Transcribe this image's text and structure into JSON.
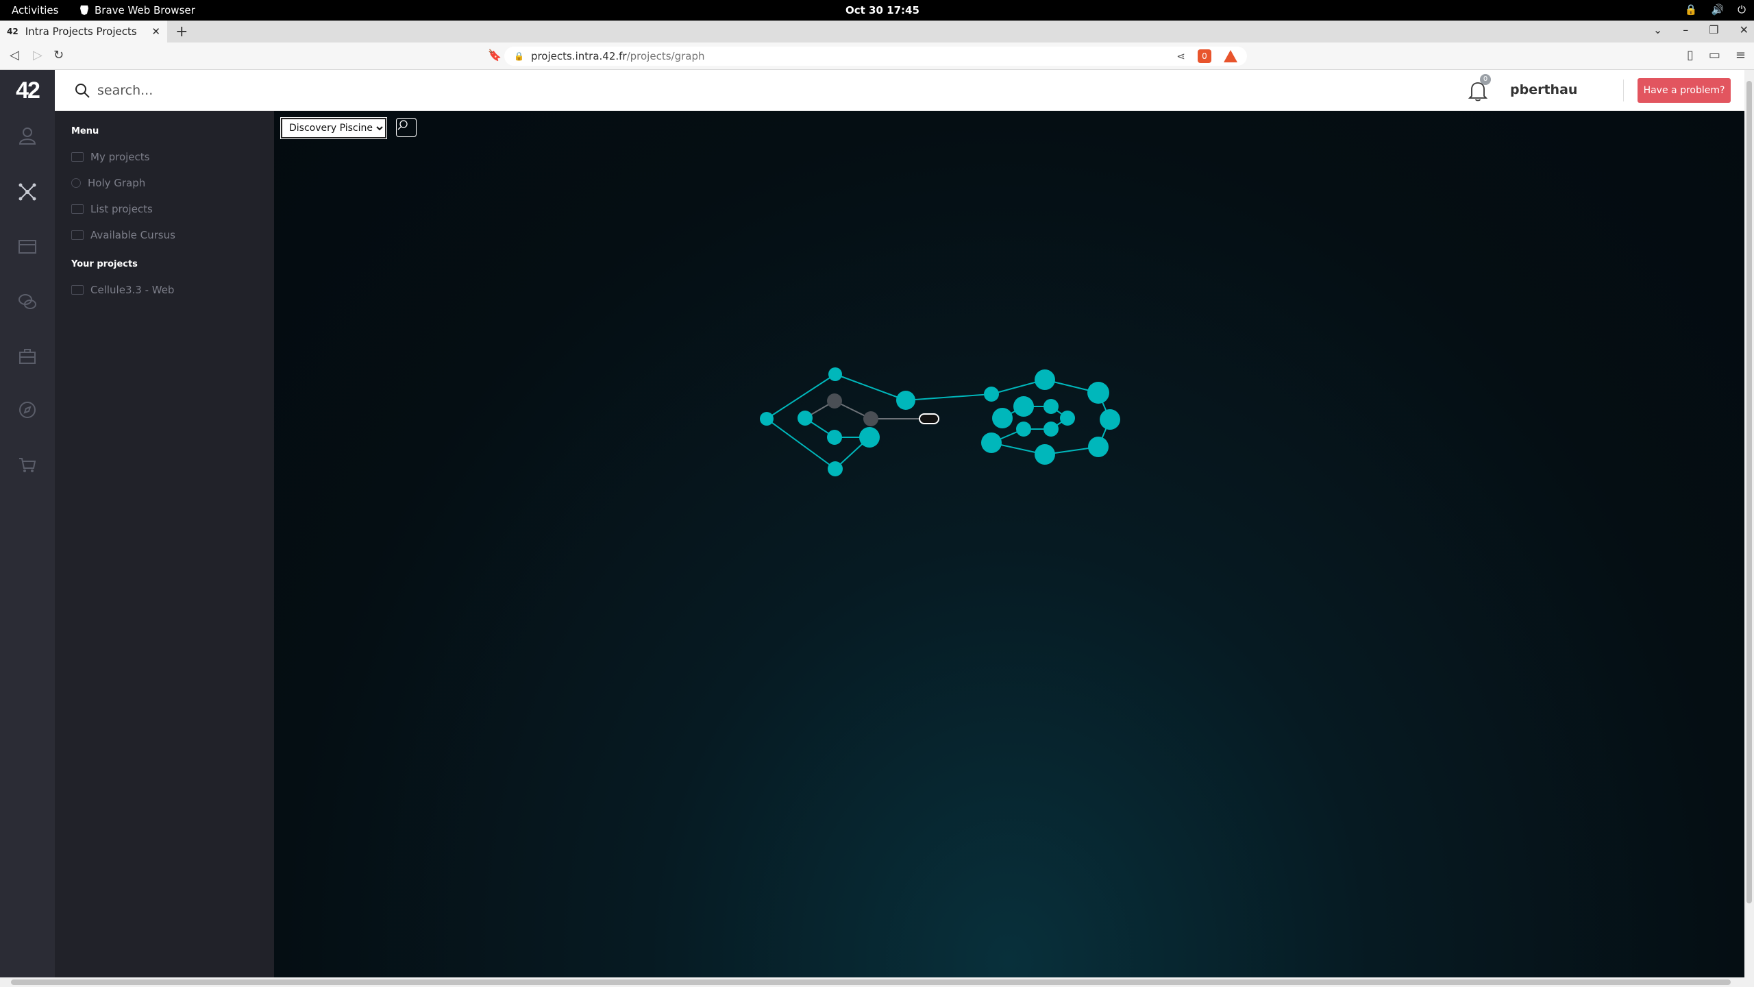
{
  "system": {
    "activities": "Activities",
    "app_name": "Brave Web Browser",
    "clock": "Oct 30  17:45"
  },
  "browser": {
    "tab_title": "Intra Projects Projects",
    "url_domain": "projects.intra.42.fr",
    "url_path": "/projects/graph",
    "shield_count": "0"
  },
  "header": {
    "logo": "42",
    "search_placeholder": "search...",
    "notification_count": "0",
    "username": "pberthau",
    "problem_button": "Have a problem?"
  },
  "sidebar": {
    "menu_heading": "Menu",
    "menu_items": [
      {
        "label": "My projects"
      },
      {
        "label": "Holy Graph"
      },
      {
        "label": "List projects"
      },
      {
        "label": "Available Cursus"
      }
    ],
    "your_projects_heading": "Your projects",
    "projects": [
      {
        "label": "Cellule3.3 - Web"
      }
    ]
  },
  "graph": {
    "cursus_selected": "Discovery Piscine",
    "accent_color": "#00b7bb",
    "locked_color": "#4a4f55"
  }
}
